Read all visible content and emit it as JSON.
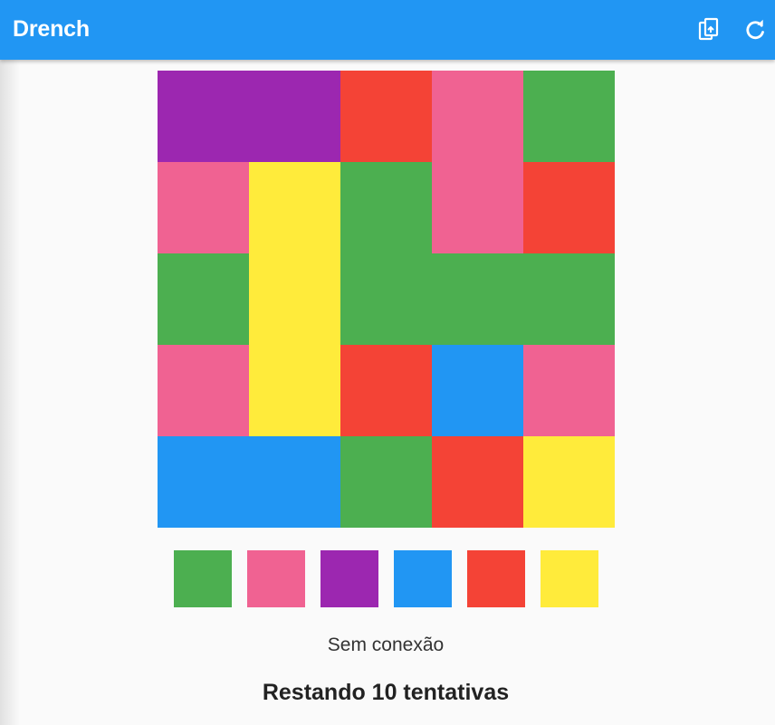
{
  "app": {
    "title": "Drench"
  },
  "header": {
    "actions": [
      {
        "icon": "copy-icon"
      },
      {
        "icon": "refresh-icon"
      }
    ]
  },
  "colors": {
    "green": "#4caf50",
    "pink": "#f06292",
    "purple": "#9c27b0",
    "blue": "#2196f3",
    "red": "#f44336",
    "yellow": "#ffeb3b"
  },
  "board": {
    "rows": [
      [
        "purple",
        "purple",
        "red",
        "pink",
        "green"
      ],
      [
        "pink",
        "yellow",
        "green",
        "pink",
        "red"
      ],
      [
        "green",
        "yellow",
        "green",
        "green",
        "green"
      ],
      [
        "pink",
        "yellow",
        "red",
        "blue",
        "pink"
      ],
      [
        "blue",
        "blue",
        "green",
        "red",
        "yellow"
      ]
    ]
  },
  "palette": [
    "green",
    "pink",
    "purple",
    "blue",
    "red",
    "yellow"
  ],
  "status": {
    "connection_text": "Sem conexão",
    "moves_text": "Restando 10 tentativas"
  }
}
